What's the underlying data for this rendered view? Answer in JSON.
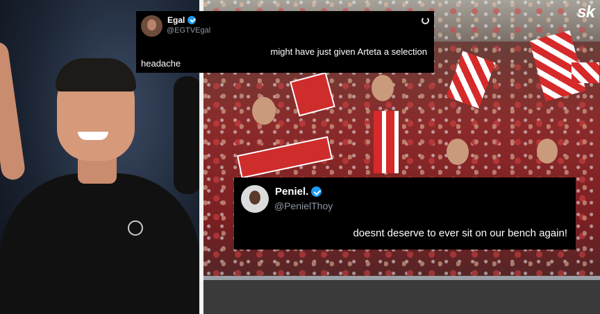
{
  "brand": {
    "logo_text": "sk"
  },
  "tweets": [
    {
      "name": "Egal",
      "handle": "@EGTVEgal",
      "text_line1": "might have just given Arteta a selection",
      "text_line2": "headache"
    },
    {
      "name": "Peniel.",
      "handle": "@PenielThoy",
      "text": "doesnt deserve to ever sit on our bench again!"
    }
  ],
  "colors": {
    "verified": "#1d9bf0",
    "arsenal_red": "#d62a2a"
  }
}
